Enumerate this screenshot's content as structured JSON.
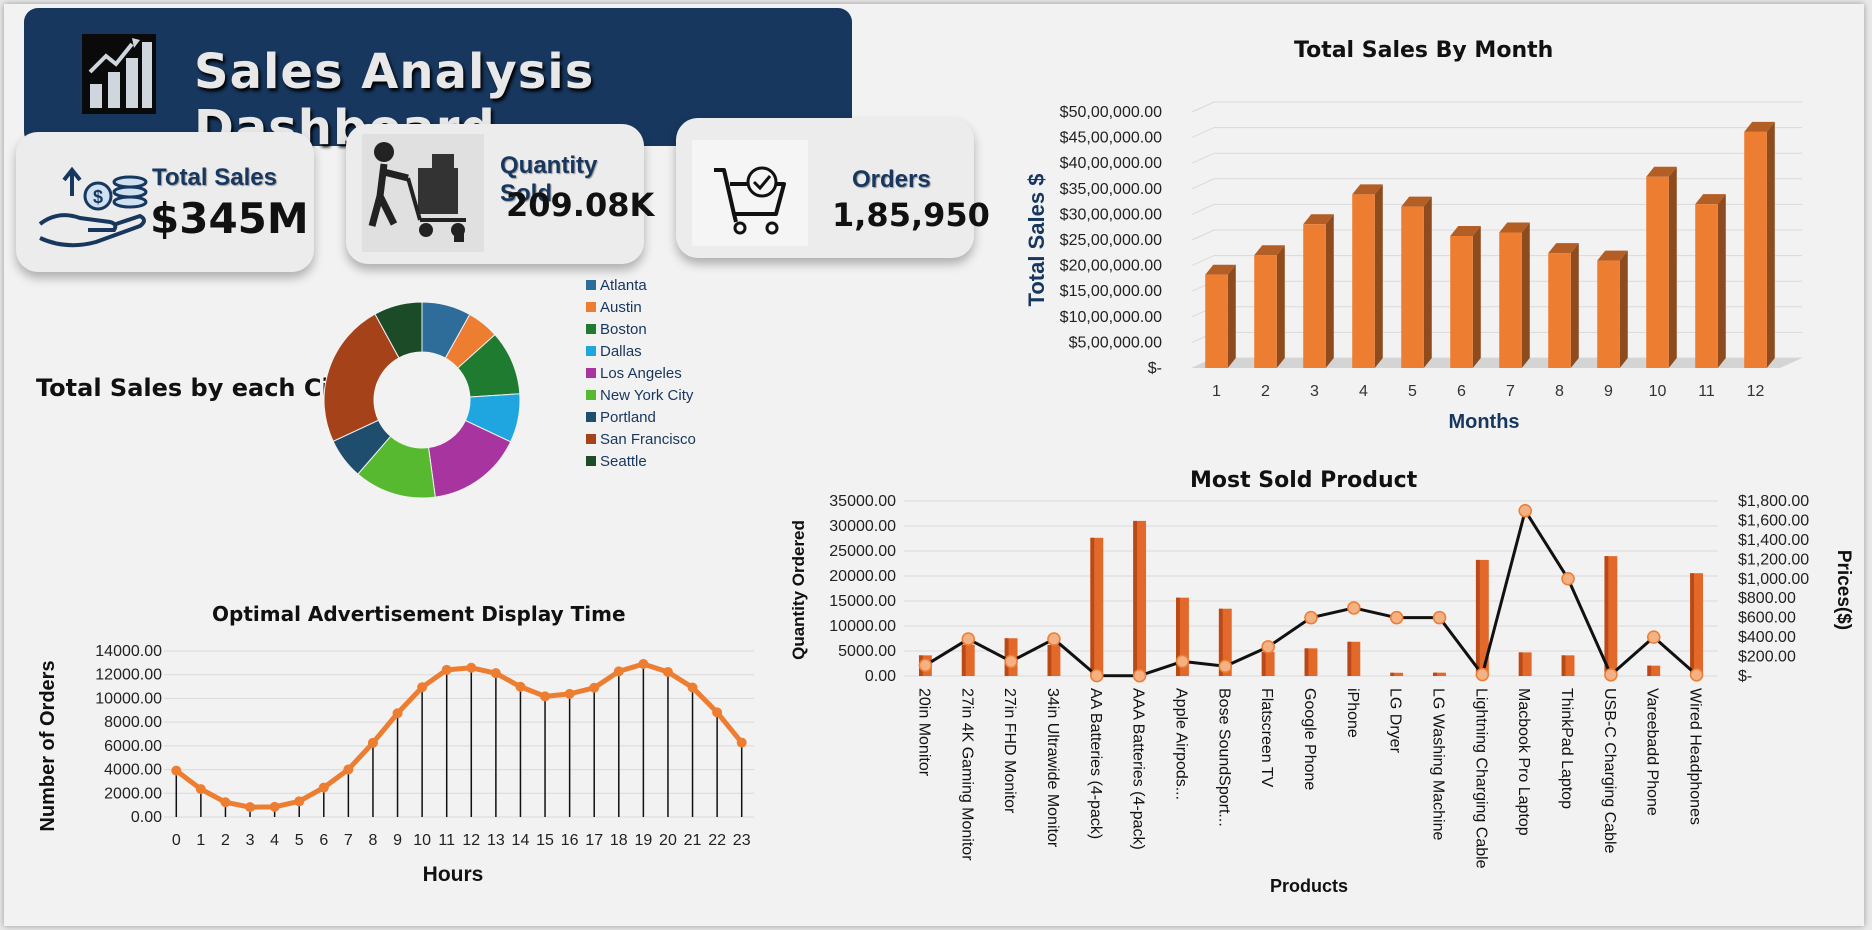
{
  "dashboard": {
    "title": "Sales Analysis Dashboard"
  },
  "kpis": {
    "total_sales": {
      "label": "Total Sales",
      "value": "$345M"
    },
    "quantity_sold": {
      "label": "Quantity Sold",
      "value": "209.08K"
    },
    "orders": {
      "label": "Orders",
      "value": "1,85,950"
    }
  },
  "colors": {
    "navy": "#17375e",
    "orange": "#ed7d31",
    "background": "#f2f2f2"
  },
  "chart_data": [
    {
      "id": "sales_by_month",
      "type": "bar",
      "title": "Total Sales By Month",
      "xlabel": "Months",
      "ylabel": "Total Sales $",
      "categories": [
        "1",
        "2",
        "3",
        "4",
        "5",
        "6",
        "7",
        "8",
        "9",
        "10",
        "11",
        "12"
      ],
      "values": [
        1822000,
        2203000,
        2807000,
        3390000,
        3152000,
        2578000,
        2647000,
        2244000,
        2098000,
        3736000,
        3200000,
        4613000
      ],
      "ylim": [
        0,
        5000000
      ],
      "yticks": [
        0,
        500000,
        1000000,
        1500000,
        2000000,
        2500000,
        3000000,
        3500000,
        4000000,
        4500000,
        5000000
      ],
      "ytick_labels": [
        "$-",
        "$5,00,000.00",
        "$10,00,000.00",
        "$15,00,000.00",
        "$20,00,000.00",
        "$25,00,000.00",
        "$30,00,000.00",
        "$35,00,000.00",
        "$40,00,000.00",
        "$45,00,000.00",
        "$50,00,000.00"
      ],
      "grid": true,
      "color": "#ed7d31"
    },
    {
      "id": "sales_by_city",
      "type": "pie",
      "title": "Total Sales by each City",
      "categories": [
        "Atlanta",
        "Austin",
        "Boston",
        "Dallas",
        "Los Angeles",
        "New York City",
        "Portland",
        "San Francisco",
        "Seattle"
      ],
      "values": [
        2795000,
        1819000,
        3661000,
        2767000,
        5452000,
        4664000,
        2320000,
        8262000,
        2747000
      ],
      "colors": [
        "#2e6c9a",
        "#ed7d31",
        "#1e7b2f",
        "#1fa6e0",
        "#a8359f",
        "#57b92f",
        "#1e4d6e",
        "#a5421a",
        "#1c4b28"
      ],
      "legend_position": "right"
    },
    {
      "id": "orders_by_hour",
      "type": "line",
      "title": "Optimal Advertisement Display Time",
      "xlabel": "Hours",
      "ylabel": "Number of Orders",
      "x": [
        0,
        1,
        2,
        3,
        4,
        5,
        6,
        7,
        8,
        9,
        10,
        11,
        12,
        13,
        14,
        15,
        16,
        17,
        18,
        19,
        20,
        21,
        22,
        23
      ],
      "values": [
        3910,
        2350,
        1243,
        831,
        854,
        1321,
        2482,
        4011,
        6256,
        8748,
        10944,
        12411,
        12587,
        12129,
        10984,
        10175,
        10384,
        10899,
        12280,
        12905,
        12228,
        10921,
        8822,
        6275
      ],
      "ylim": [
        0,
        14000
      ],
      "yticks": [
        0,
        2000,
        4000,
        6000,
        8000,
        10000,
        12000,
        14000
      ],
      "ytick_labels": [
        "0.00",
        "2000.00",
        "4000.00",
        "6000.00",
        "8000.00",
        "10000.00",
        "12000.00",
        "14000.00"
      ],
      "grid": true,
      "color": "#ed7d31"
    },
    {
      "id": "most_sold_product",
      "type": "bar",
      "title": "Most Sold Product",
      "xlabel": "Products",
      "ylabel": "Quantity Ordered",
      "y2label": "Prices($)",
      "categories": [
        "20in Monitor",
        "27in 4K Gaming Monitor",
        "27in FHD Monitor",
        "34in Ultrawide Monitor",
        "AA Batteries (4-pack)",
        "AAA Batteries (4-pack)",
        "Apple Airpods...",
        "Bose SoundSport...",
        "Flatscreen TV",
        "Google Phone",
        "iPhone",
        "LG Dryer",
        "LG Washing Machine",
        "Lightning Charging Cable",
        "Macbook Pro Laptop",
        "ThinkPad Laptop",
        "USB-C Charging Cable",
        "Vareebadd Phone",
        "Wired Headphones"
      ],
      "series": [
        {
          "name": "Quantity Ordered",
          "type": "bar",
          "axis": "left",
          "values": [
            4129,
            6244,
            7550,
            6199,
            27635,
            31017,
            15661,
            13457,
            4819,
            5532,
            6849,
            646,
            666,
            23217,
            4728,
            4130,
            23975,
            2068,
            20557
          ]
        },
        {
          "name": "Prices($)",
          "type": "line",
          "axis": "right",
          "values": [
            109.99,
            379.99,
            149.99,
            379.99,
            3.84,
            2.99,
            150,
            99.99,
            300,
            600,
            700,
            600,
            600,
            14.95,
            1700,
            999.99,
            11.95,
            400,
            11.99
          ]
        }
      ],
      "ylim": [
        0,
        35000
      ],
      "yticks": [
        0,
        5000,
        10000,
        15000,
        20000,
        25000,
        30000,
        35000
      ],
      "ytick_labels": [
        "0.00",
        "5000.00",
        "10000.00",
        "15000.00",
        "20000.00",
        "25000.00",
        "30000.00",
        "35000.00"
      ],
      "y2lim": [
        0,
        1800
      ],
      "y2ticks": [
        0,
        200,
        400,
        600,
        800,
        1000,
        1200,
        1400,
        1600,
        1800
      ],
      "y2tick_labels": [
        "$-",
        "$200.00",
        "$400.00",
        "$600.00",
        "$800.00",
        "$1,000.00",
        "$1,200.00",
        "$1,400.00",
        "$1,600.00",
        "$1,800.00"
      ],
      "grid": true
    }
  ]
}
